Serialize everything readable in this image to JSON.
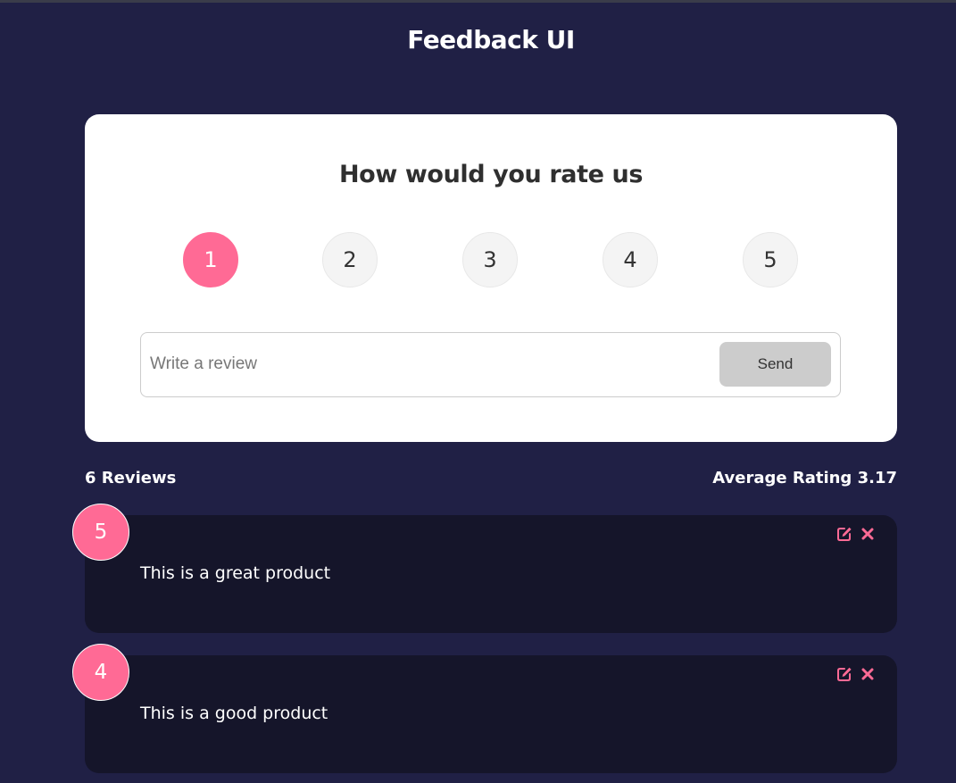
{
  "app": {
    "title": "Feedback UI"
  },
  "rating_card": {
    "heading": "How would you rate us",
    "options": [
      "1",
      "2",
      "3",
      "4",
      "5"
    ],
    "selected": "1",
    "review_placeholder": "Write a review",
    "review_value": "",
    "send_label": "Send"
  },
  "stats": {
    "reviews_count": "6 Reviews",
    "average_rating": "Average Rating 3.17"
  },
  "reviews": [
    {
      "rating": "5",
      "text": "This is a great product",
      "edit_icon": "edit-icon",
      "delete_icon": "close-icon"
    },
    {
      "rating": "4",
      "text": "This is a good product",
      "edit_icon": "edit-icon",
      "delete_icon": "close-icon"
    }
  ],
  "colors": {
    "background": "#202045",
    "accent": "#ff6a95",
    "card": "#ffffff",
    "review_card": "#15152a",
    "send_button": "#cccccc"
  }
}
